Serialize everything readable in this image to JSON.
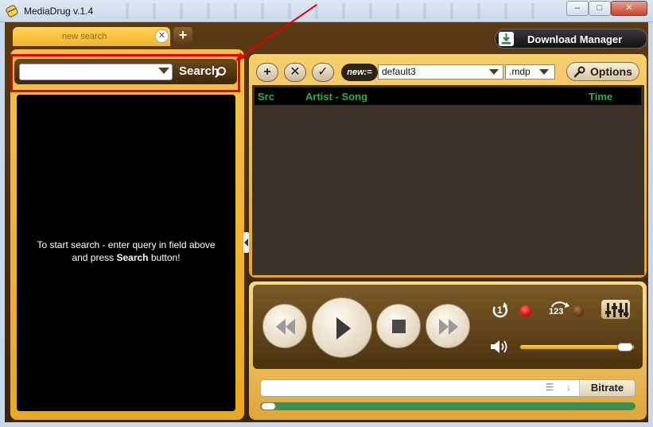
{
  "window": {
    "title": "MediaDrug v.1.4",
    "minimize_glyph": "–",
    "maximize_glyph": "□",
    "close_glyph": "✕"
  },
  "tabs": {
    "items": [
      {
        "label": "new search"
      }
    ],
    "close_glyph": "✕",
    "add_glyph": "+"
  },
  "toolbar": {
    "download_manager_label": "Download Manager"
  },
  "search": {
    "value": "",
    "placeholder": "",
    "button_label": "Search",
    "hint_line1": "To start search - enter query in field above",
    "hint_line2_prefix": "and press ",
    "hint_line2_bold": "Search",
    "hint_line2_suffix": " button!"
  },
  "playlist": {
    "add_glyph": "+",
    "remove_glyph": "✕",
    "check_glyph": "✓",
    "new_badge": "new:=",
    "selected_playlist": "default3",
    "extension": ".mdp",
    "options_label": "Options",
    "columns": {
      "src": "Src",
      "artist_song": "Artist - Song",
      "time": "Time"
    }
  },
  "player": {
    "repeat_label": "1",
    "shuffle_label": "123",
    "volume_fraction": 0.95,
    "seek_fraction": 0.0,
    "bitrate_label": "Bitrate"
  },
  "colors": {
    "accent": "#f3b52a",
    "highlight": "#e50000",
    "column_header_text": "#27b04a",
    "led_red": "#e01010",
    "led_dark": "#6a3c18"
  }
}
